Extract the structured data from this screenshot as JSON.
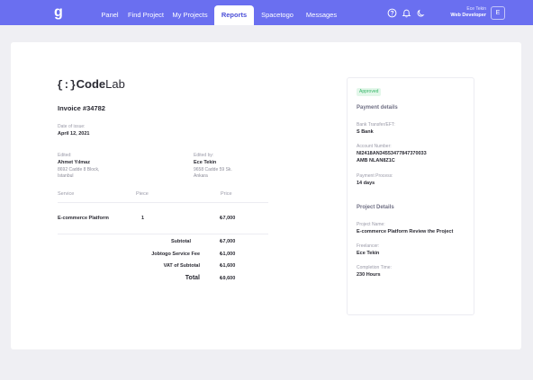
{
  "header": {
    "logo_glyph": "g",
    "nav": [
      "Panel",
      "Find Project",
      "My Projects",
      "Reports",
      "Spacetogo",
      "Messages"
    ],
    "active_tab": "Reports",
    "icons": [
      "help-circle-icon",
      "bell-icon",
      "moon-icon"
    ],
    "user": {
      "name": "Ece Tekin",
      "role": "Web Developer",
      "avatar_initial": "E"
    }
  },
  "invoice": {
    "brand": {
      "open": "{",
      "close": "}",
      "dots": ":",
      "code": "Code",
      "lab": "Lab"
    },
    "title": "Invoice #34782",
    "date_label": "Date of issue:",
    "date": "April 12, 2021",
    "edited": {
      "label": "Edited:",
      "name": "Ahmet Yılmaz",
      "address1": "8692 Cadde 8 Block,",
      "address2": "Istanbul"
    },
    "edited_by": {
      "label": "Edited by:",
      "name": "Ece Tekin",
      "address1": "9658 Cadde 59 Sk.",
      "address2": "Ankara"
    },
    "table": {
      "headers": {
        "service": "Service",
        "piece": "Piece",
        "price": "Price"
      },
      "rows": [
        {
          "service": "E-commerce Platform",
          "piece": "1",
          "price": "₺7,000"
        }
      ]
    },
    "summary": {
      "subtotal_label": "Subtotal",
      "subtotal": "₺7,000",
      "fee_label": "Jobtogo Service Fee",
      "fee": "₺1,000",
      "vat_label": "VAT of Subtotal",
      "vat": "₺1,600",
      "total_label": "Total",
      "total": "₺9,600"
    }
  },
  "sidebar": {
    "status": "Approved",
    "payment_title": "Payment details",
    "transfer_label": "Bank Transfer/EFT:",
    "bank": "S Bank",
    "account_label": "Account Number:",
    "account_line1": "NI2418AN34553477847370033",
    "account_line2": "AMB NLAN8Z1C",
    "process_label": "Payment Process:",
    "process": "14 days",
    "project_title": "Project Details",
    "project_name_label": "Project Name:",
    "project_name": "E-commerce Platform Review the Project",
    "freelancer_label": "Freelancer:",
    "freelancer": "Ece Tekin",
    "completion_label": "Completion Time:",
    "completion": "230 Hours"
  },
  "colors": {
    "accent": "#6a6ff0",
    "approved_text": "#33b566",
    "approved_bg": "#e3f7ea"
  }
}
